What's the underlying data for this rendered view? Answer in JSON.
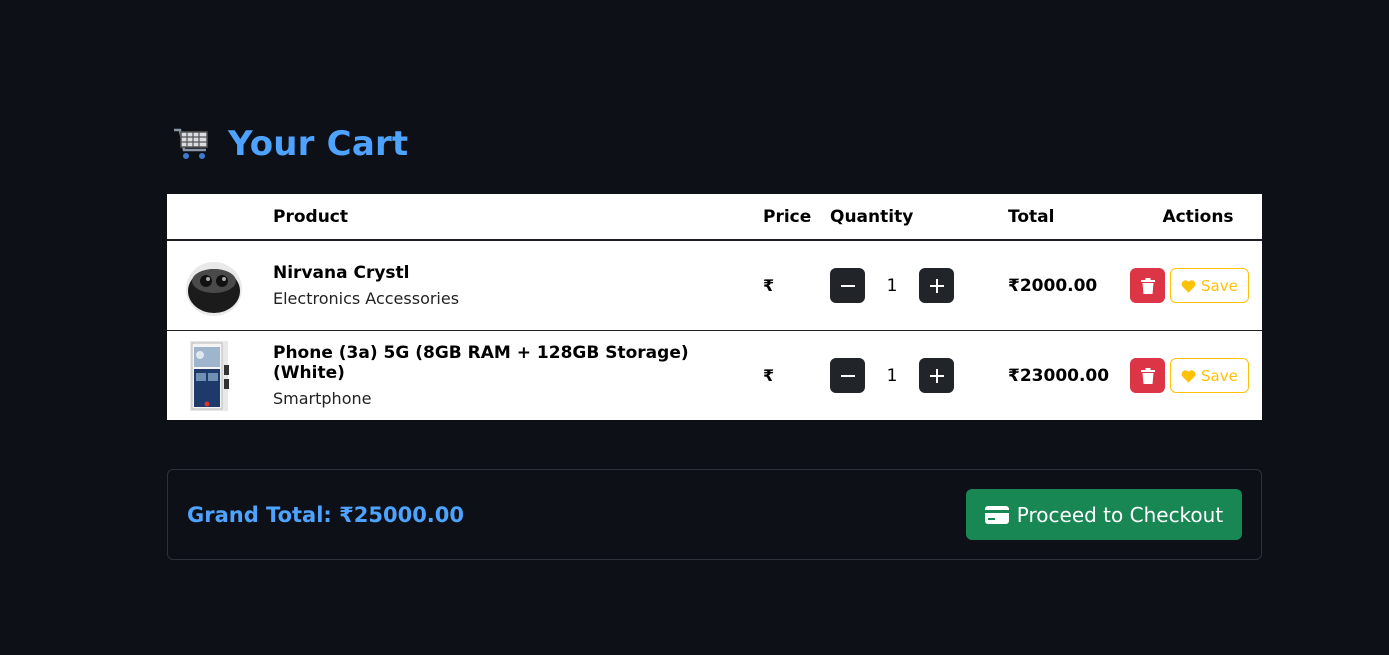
{
  "page": {
    "title": "Your Cart",
    "cart_icon": "shopping-cart-icon"
  },
  "table": {
    "headers": {
      "image": "",
      "product": "Product",
      "price": "Price",
      "quantity": "Quantity",
      "total": "Total",
      "actions": "Actions"
    },
    "items": [
      {
        "name": "Nirvana Crystl",
        "category": "Electronics Accessories",
        "price": "₹",
        "quantity": "1",
        "total": "₹2000.00",
        "save_label": "Save"
      },
      {
        "name": "Phone (3a) 5G (8GB RAM + 128GB Storage) (White)",
        "category": "Smartphone",
        "price": "₹",
        "quantity": "1",
        "total": "₹23000.00",
        "save_label": "Save"
      }
    ]
  },
  "summary": {
    "grand_total": "Grand Total: ₹25000.00",
    "checkout_label": "Proceed to Checkout"
  },
  "colors": {
    "background": "#0d1017",
    "accent": "#4da3ff",
    "danger": "#dc3545",
    "warning": "#ffc107",
    "success": "#198754"
  }
}
